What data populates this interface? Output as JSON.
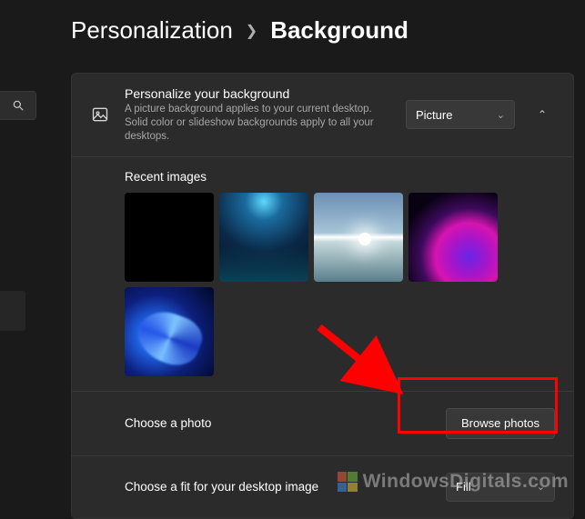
{
  "breadcrumb": {
    "parent": "Personalization",
    "current": "Background"
  },
  "personalize": {
    "title": "Personalize your background",
    "subtitle": "A picture background applies to your current desktop. Solid color or slideshow backgrounds apply to all your desktops.",
    "select_value": "Picture"
  },
  "recent": {
    "title": "Recent images"
  },
  "choose_photo": {
    "label": "Choose a photo",
    "button": "Browse photos"
  },
  "choose_fit": {
    "label": "Choose a fit for your desktop image",
    "select_value": "Fill"
  },
  "watermark": "WindowsDigitals.com"
}
